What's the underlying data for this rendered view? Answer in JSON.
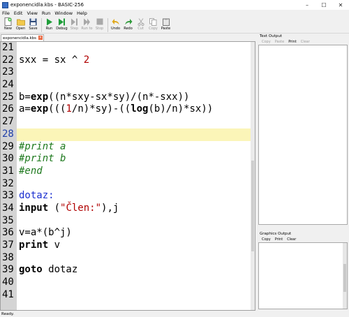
{
  "window": {
    "title": "exponencidla.kbs - BASIC-256"
  },
  "menu": [
    "File",
    "Edit",
    "View",
    "Run",
    "Window",
    "Help"
  ],
  "toolbar": {
    "new": "New",
    "open": "Open",
    "save": "Save",
    "run": "Run",
    "debug": "Debug",
    "step": "Step",
    "run_to": "Run to",
    "stop": "Stop",
    "undo": "Undo",
    "redo": "Redo",
    "cut": "Cut",
    "copy": "Copy",
    "paste": "Paste"
  },
  "tab": {
    "label": "exponencidla.kbs"
  },
  "editor": {
    "lines": [
      {
        "n": "21",
        "code": ""
      },
      {
        "n": "22",
        "code": "sxx = sx ^ 2"
      },
      {
        "n": "23",
        "code": ""
      },
      {
        "n": "24",
        "code": ""
      },
      {
        "n": "25",
        "code": "b=exp((n*sxy-sx*sy)/(n*sx2-sxx))"
      },
      {
        "n": "26",
        "code": "a=exp(((1/n)*sy)-((log(b)/n)*sx))"
      },
      {
        "n": "27",
        "code": ""
      },
      {
        "n": "28",
        "code": ""
      },
      {
        "n": "29",
        "code": "#print a"
      },
      {
        "n": "30",
        "code": "#print b"
      },
      {
        "n": "31",
        "code": "#end"
      },
      {
        "n": "32",
        "code": ""
      },
      {
        "n": "33",
        "code": "dotaz:"
      },
      {
        "n": "34",
        "code": "input (\"Člen:\"),j"
      },
      {
        "n": "35",
        "code": ""
      },
      {
        "n": "36",
        "code": "v=a*(b^j)"
      },
      {
        "n": "37",
        "code": "print v"
      },
      {
        "n": "38",
        "code": ""
      },
      {
        "n": "39",
        "code": "goto dotaz"
      },
      {
        "n": "40",
        "code": ""
      },
      {
        "n": "41",
        "code": ""
      }
    ]
  },
  "text_output": {
    "title": "Text Output",
    "copy": "Copy",
    "paste": "Paste",
    "print": "Print",
    "clear": "Clear"
  },
  "graphics_output": {
    "title": "Graphics Output",
    "copy": "Copy",
    "print": "Print",
    "clear": "Clear"
  },
  "status": {
    "text": "Ready."
  }
}
